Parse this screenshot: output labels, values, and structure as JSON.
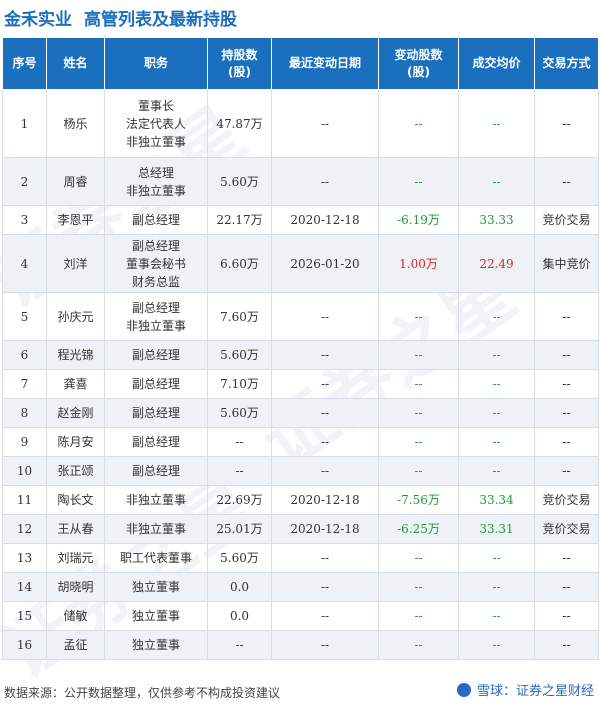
{
  "header": {
    "company": "金禾实业",
    "title": "高管列表及最新持股"
  },
  "columns": [
    "序号",
    "姓名",
    "职务",
    "持股数\n(股)",
    "最近变动日期",
    "变动股数\n(股)",
    "成交均价",
    "交易方式"
  ],
  "rows": [
    {
      "no": "1",
      "name": "杨乐",
      "roles": [
        "董事长",
        "法定代表人",
        "非独立董事"
      ],
      "shares": "47.87万",
      "date": "--",
      "change": "--",
      "price": "--",
      "method": "--"
    },
    {
      "no": "2",
      "name": "周睿",
      "roles": [
        "总经理",
        "非独立董事"
      ],
      "shares": "5.60万",
      "date": "--",
      "change": "--",
      "price": "--",
      "method": "--"
    },
    {
      "no": "3",
      "name": "李恩平",
      "roles": [
        "副总经理"
      ],
      "shares": "22.17万",
      "date": "2020-12-18",
      "change": "-6.19万",
      "price": "33.33",
      "method": "竞价交易"
    },
    {
      "no": "4",
      "name": "刘洋",
      "roles": [
        "副总经理",
        "董事会秘书",
        "财务总监"
      ],
      "shares": "6.60万",
      "date": "2026-01-20",
      "change": "1.00万",
      "price": "22.49",
      "method": "集中竞价"
    },
    {
      "no": "5",
      "name": "孙庆元",
      "roles": [
        "副总经理",
        "非独立董事"
      ],
      "shares": "7.60万",
      "date": "--",
      "change": "--",
      "price": "--",
      "method": "--"
    },
    {
      "no": "6",
      "name": "程光锦",
      "roles": [
        "副总经理"
      ],
      "shares": "5.60万",
      "date": "--",
      "change": "--",
      "price": "--",
      "method": "--"
    },
    {
      "no": "7",
      "name": "龚喜",
      "roles": [
        "副总经理"
      ],
      "shares": "7.10万",
      "date": "--",
      "change": "--",
      "price": "--",
      "method": "--"
    },
    {
      "no": "8",
      "name": "赵金刚",
      "roles": [
        "副总经理"
      ],
      "shares": "5.60万",
      "date": "--",
      "change": "--",
      "price": "--",
      "method": "--"
    },
    {
      "no": "9",
      "name": "陈月安",
      "roles": [
        "副总经理"
      ],
      "shares": "--",
      "date": "--",
      "change": "--",
      "price": "--",
      "method": "--"
    },
    {
      "no": "10",
      "name": "张正颂",
      "roles": [
        "副总经理"
      ],
      "shares": "--",
      "date": "--",
      "change": "--",
      "price": "--",
      "method": "--"
    },
    {
      "no": "11",
      "name": "陶长文",
      "roles": [
        "非独立董事"
      ],
      "shares": "22.69万",
      "date": "2020-12-18",
      "change": "-7.56万",
      "price": "33.34",
      "method": "竞价交易"
    },
    {
      "no": "12",
      "name": "王从春",
      "roles": [
        "非独立董事"
      ],
      "shares": "25.01万",
      "date": "2020-12-18",
      "change": "-6.25万",
      "price": "33.31",
      "method": "竞价交易"
    },
    {
      "no": "13",
      "name": "刘瑞元",
      "roles": [
        "职工代表董事"
      ],
      "shares": "5.60万",
      "date": "--",
      "change": "--",
      "price": "--",
      "method": "--"
    },
    {
      "no": "14",
      "name": "胡晓明",
      "roles": [
        "独立董事"
      ],
      "shares": "0.0",
      "date": "--",
      "change": "--",
      "price": "--",
      "method": "--"
    },
    {
      "no": "15",
      "name": "储敏",
      "roles": [
        "独立董事"
      ],
      "shares": "0.0",
      "date": "--",
      "change": "--",
      "price": "--",
      "method": "--"
    },
    {
      "no": "16",
      "name": "孟征",
      "roles": [
        "独立董事"
      ],
      "shares": "--",
      "date": "--",
      "change": "--",
      "price": "--",
      "method": "--"
    }
  ],
  "footer": {
    "source": "数据来源：公开数据整理，仅供参考不构成投资建议",
    "brand": "雪球：证券之星财经"
  },
  "watermark": "证券之星",
  "colors": {
    "header_bg": "#1a6fbf",
    "positive": "#d9262b",
    "negative": "#1e9a3a",
    "alt_row": "#eef2f7"
  }
}
